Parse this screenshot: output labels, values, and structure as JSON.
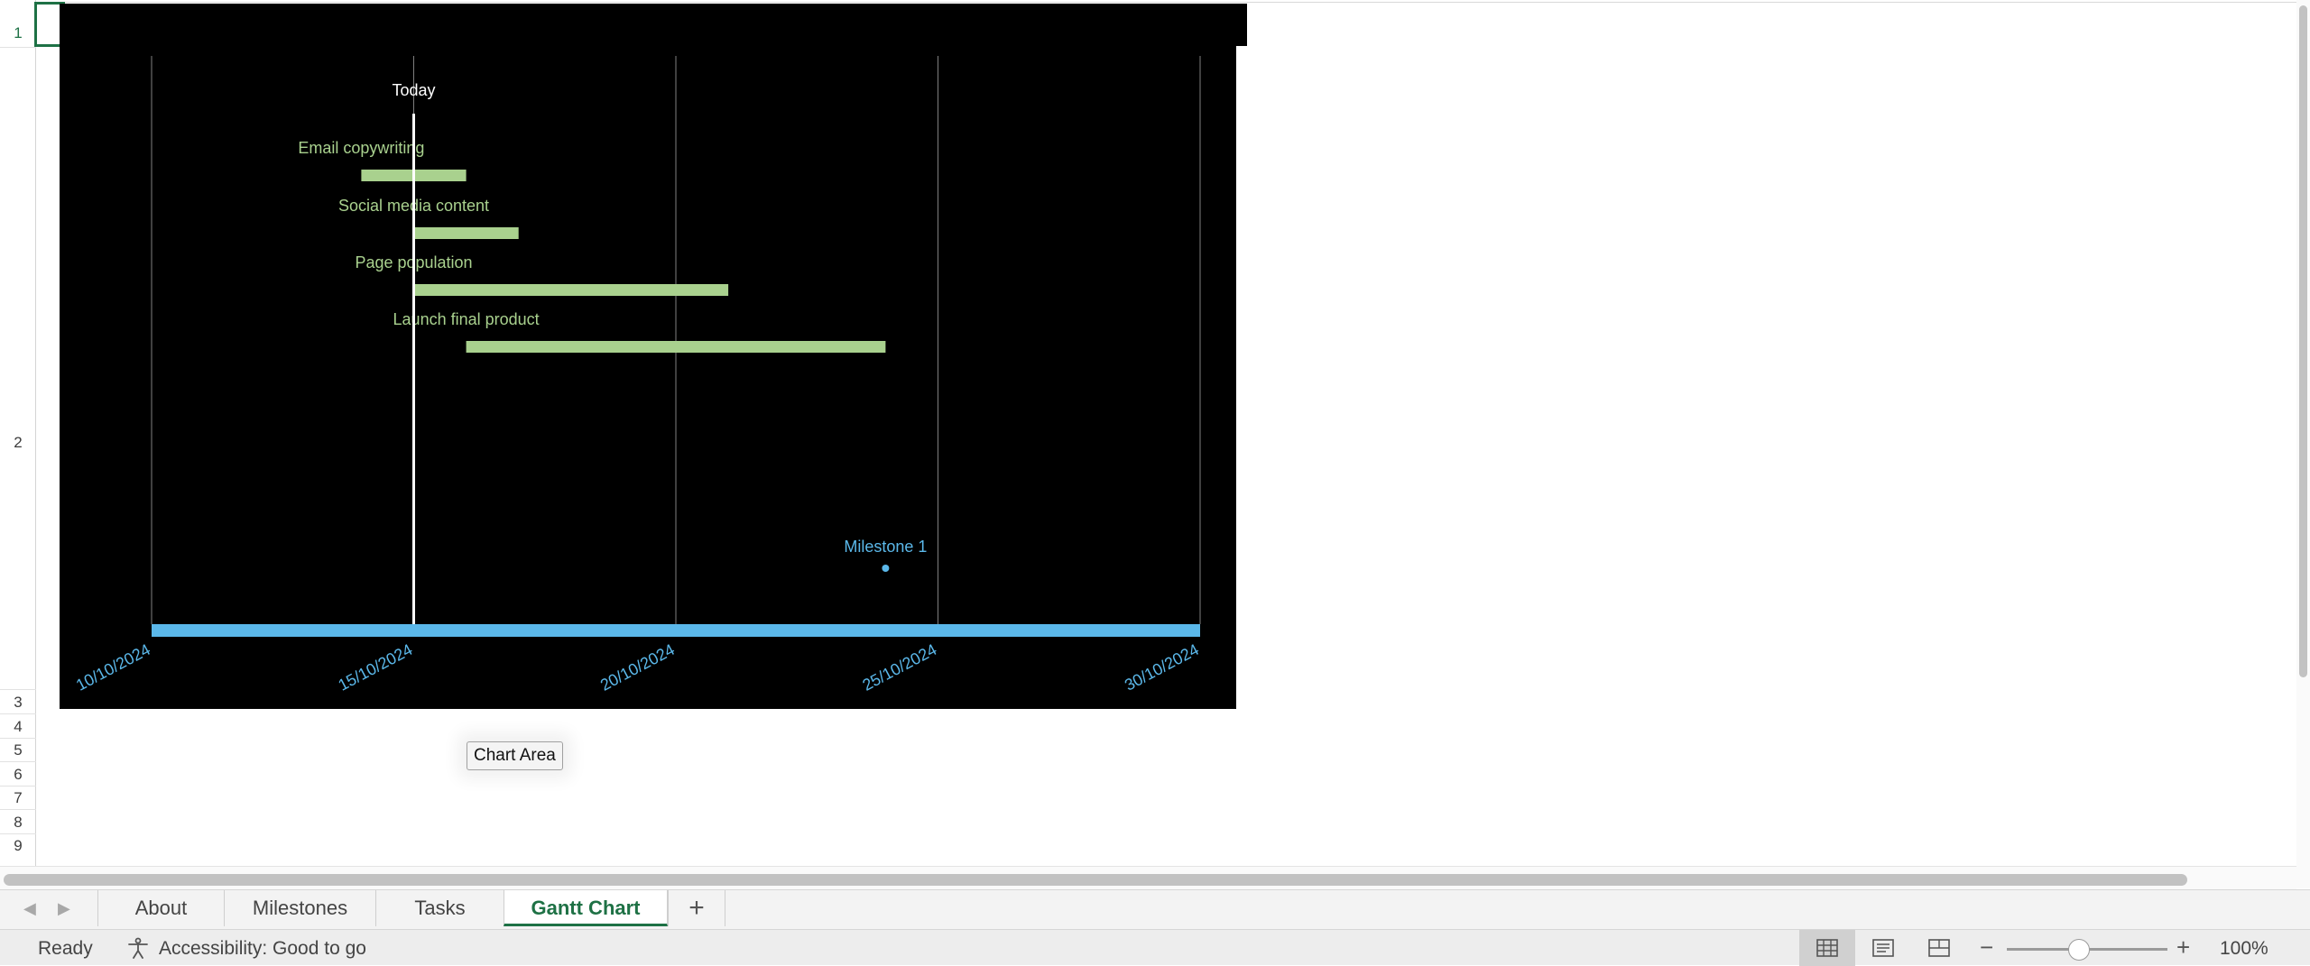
{
  "sheet": {
    "rows": [
      "1",
      "2",
      "3",
      "4",
      "5",
      "6",
      "7",
      "8",
      "9"
    ]
  },
  "chart_data": {
    "type": "bar",
    "orientation": "horizontal-gantt",
    "today_label": "Today",
    "today_date": "15/10/2024",
    "tasks": [
      {
        "name": "Email copywriting",
        "start": "14/10/2024",
        "end": "16/10/2024"
      },
      {
        "name": "Social media content",
        "start": "15/10/2024",
        "end": "17/10/2024"
      },
      {
        "name": "Page population",
        "start": "15/10/2024",
        "end": "21/10/2024"
      },
      {
        "name": "Launch final product",
        "start": "16/10/2024",
        "end": "24/10/2024"
      }
    ],
    "milestones": [
      {
        "name": "Milestone 1",
        "date": "24/10/2024"
      }
    ],
    "x_ticks": [
      "10/10/2024",
      "15/10/2024",
      "20/10/2024",
      "25/10/2024",
      "30/10/2024"
    ],
    "xlim": [
      "10/10/2024",
      "30/10/2024"
    ],
    "grid": true,
    "colors": {
      "background": "#000000",
      "task_bar": "#a9d18e",
      "timeline": "#5bb8ea",
      "today_line": "#ffffff",
      "gridline": "#7f7f7f"
    }
  },
  "tooltip": {
    "text": "Chart Area"
  },
  "tabs": {
    "items": [
      "About",
      "Milestones",
      "Tasks",
      "Gantt Chart"
    ],
    "active": "Gantt Chart",
    "add_label": "+"
  },
  "status": {
    "ready": "Ready",
    "accessibility": "Accessibility: Good to go",
    "zoom": "100%",
    "zoom_fraction": 0.45
  },
  "icons": {
    "prev_sheet": "chevron-left-icon",
    "next_sheet": "chevron-right-icon",
    "accessibility": "accessibility-icon",
    "normal_view": "grid-icon",
    "page_layout": "page-layout-icon",
    "page_break": "page-break-icon"
  }
}
